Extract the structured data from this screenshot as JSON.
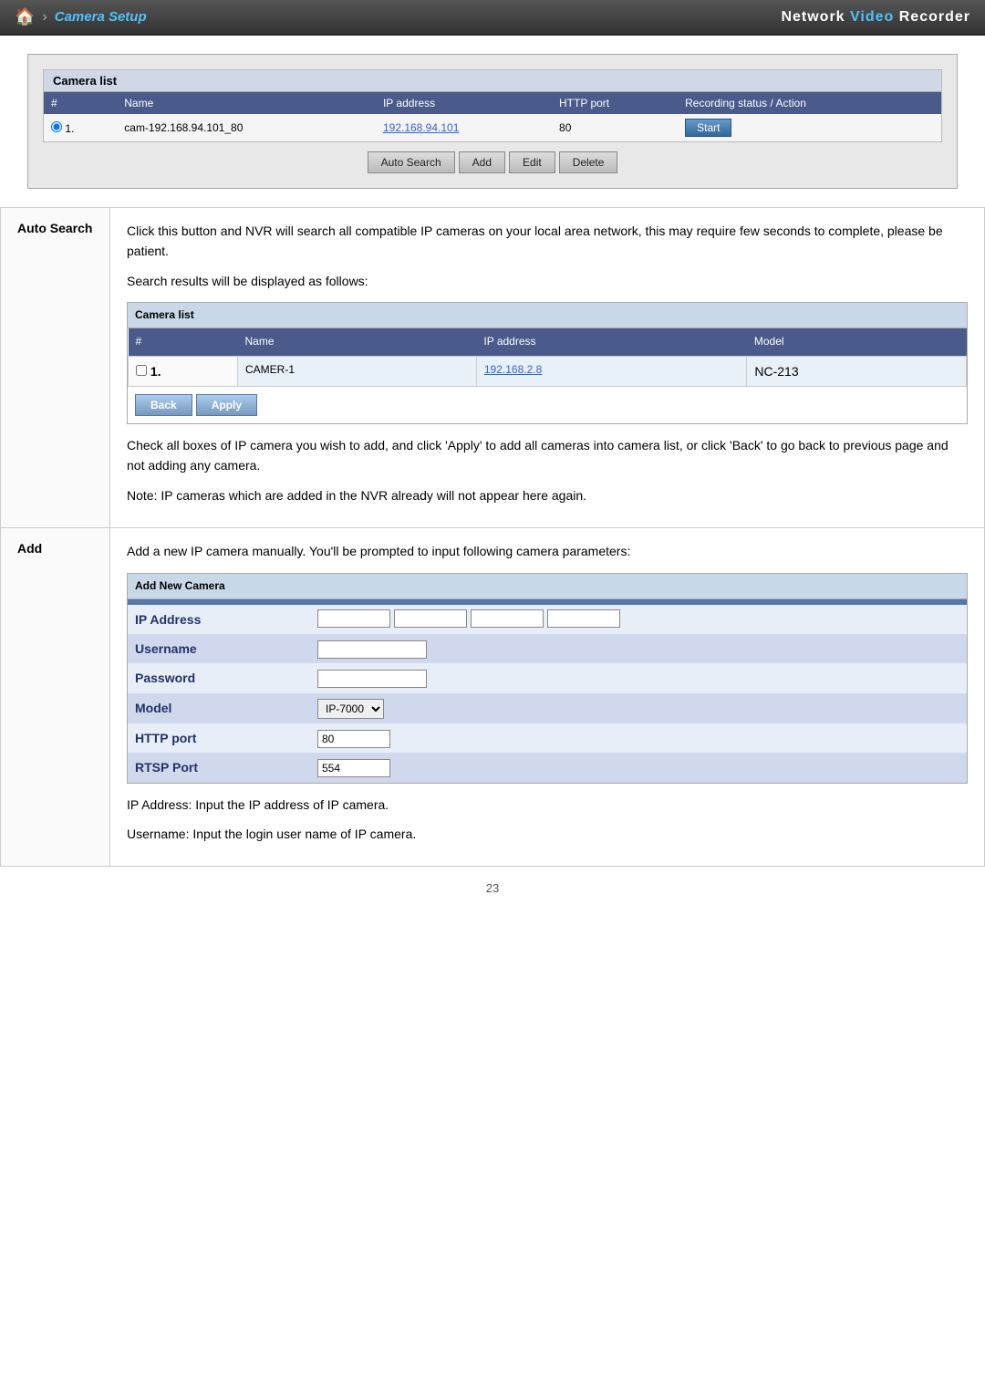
{
  "header": {
    "home_icon": "🏠",
    "chevron": "›",
    "section_title": "Camera Setup",
    "brand": "Network Video Recorder"
  },
  "camera_setup_panel": {
    "title": "Camera list",
    "table": {
      "headers": [
        "#",
        "Name",
        "IP address",
        "HTTP port",
        "Recording status / Action"
      ],
      "rows": [
        {
          "num": "1.",
          "name": "cam-192.168.94.101_80",
          "ip": "192.168.94.101",
          "port": "80",
          "action": "Start"
        }
      ]
    },
    "buttons": {
      "auto_search": "Auto Search",
      "add": "Add",
      "edit": "Edit",
      "delete": "Delete"
    }
  },
  "main": {
    "rows": [
      {
        "item": "Auto Search",
        "desc_para1": "Click this button and NVR will search all compatible IP cameras on your local area network, this may require few seconds to complete, please be patient.",
        "desc_para2": "Search results will be displayed as follows:",
        "inner_list": {
          "title": "Camera list",
          "headers": [
            "#",
            "Name",
            "IP address",
            "Model"
          ],
          "rows": [
            {
              "num": "1.",
              "name": "CAMER-1",
              "ip": "192.168.2.8",
              "model": "NC-213"
            }
          ],
          "buttons": {
            "back": "Back",
            "apply": "Apply"
          }
        },
        "desc_para3": "Check all boxes of IP camera you wish to add, and click 'Apply' to add all cameras into camera list, or click 'Back' to go back to previous page and not adding any camera.",
        "desc_para4": "Note: IP cameras which are added in the NVR already will not appear here again."
      },
      {
        "item": "Add",
        "desc_para1": "Add a new IP camera manually. You'll be prompted to input following camera parameters:",
        "form": {
          "title": "Add New Camera",
          "fields": [
            {
              "label": "IP Address",
              "type": "ip"
            },
            {
              "label": "Username",
              "type": "text"
            },
            {
              "label": "Password",
              "type": "text"
            },
            {
              "label": "Model",
              "type": "select",
              "value": "IP-7000"
            },
            {
              "label": "HTTP port",
              "type": "text",
              "value": "80"
            },
            {
              "label": "RTSP Port",
              "type": "text",
              "value": "554"
            }
          ]
        },
        "desc_ip": "IP Address: Input the IP address of IP camera.",
        "desc_username": "Username: Input the login user name of IP camera."
      }
    ]
  },
  "page_number": "23"
}
